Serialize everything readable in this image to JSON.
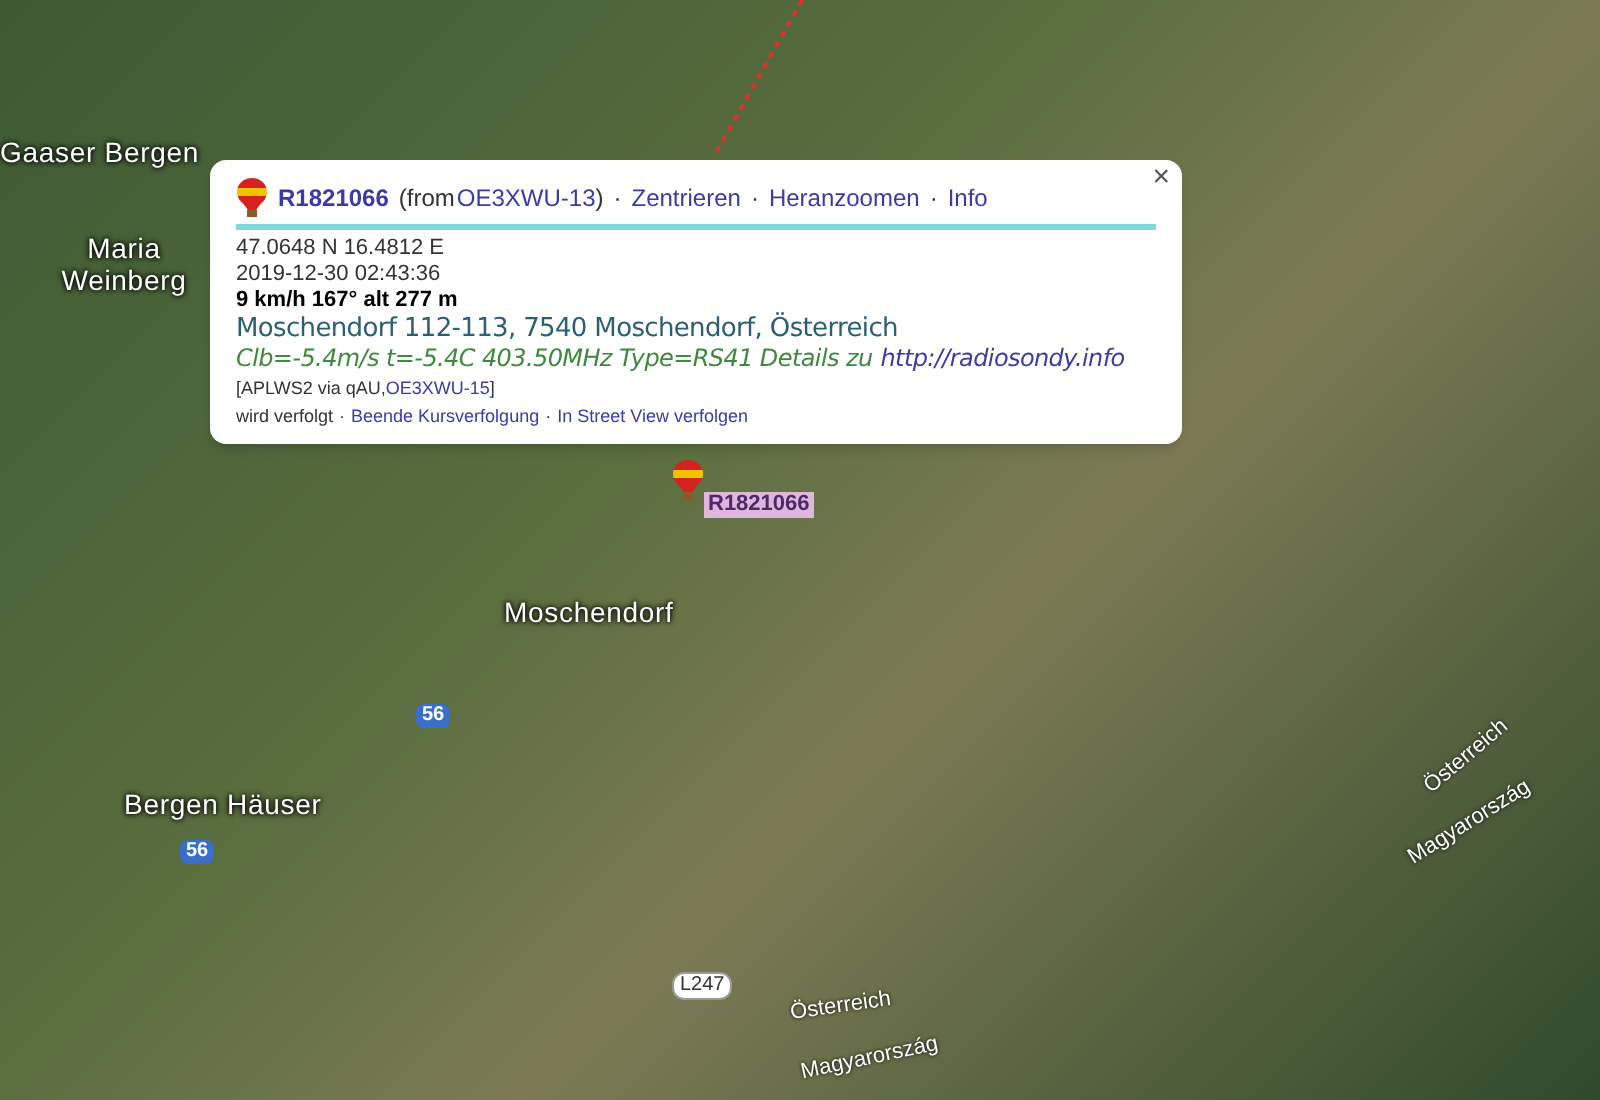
{
  "map": {
    "labels": [
      {
        "text": "Gaaser Bergen",
        "kind": "place"
      },
      {
        "text": "Maria Weinberg",
        "kind": "place"
      },
      {
        "text": "Moschendorf",
        "kind": "place"
      },
      {
        "text": "Bergen Häuser",
        "kind": "place"
      },
      {
        "text": "56",
        "kind": "shield"
      },
      {
        "text": "56",
        "kind": "shield"
      },
      {
        "text": "L247",
        "kind": "road"
      },
      {
        "text": "Österreich",
        "kind": "border"
      },
      {
        "text": "Magyarország",
        "kind": "border"
      },
      {
        "text": "Österreich",
        "kind": "border"
      },
      {
        "text": "Magyarország",
        "kind": "border"
      }
    ]
  },
  "popup": {
    "close": "×",
    "header": {
      "callsign": "R1821066",
      "source_prefix": "(from",
      "source": "OE3XWU-13",
      "source_suffix": ")",
      "separator": "·",
      "links": [
        "Zentrieren",
        "Heranzoomen",
        "Info"
      ]
    },
    "position": "47.0648 N 16.4812 E",
    "time": "2019-12-30 02:43:36",
    "motion": "9 km/h 167° alt 277 m",
    "address": "Moschendorf 112-113, 7540 Moschendorf, Österreich",
    "comment": "Clb=-5.4m/s t=-5.4C 403.50MHz Type=RS41 Details zu",
    "comment_link": "http://radiosondy.info",
    "path_prefix": "[APLWS2 via qAU,",
    "path_link": "OE3XWU-15",
    "path_suffix": "]",
    "tracking": "wird verfolgt",
    "tracking_links": [
      "Beende Kursverfolgung",
      "In Street View verfolgen"
    ]
  },
  "marker": {
    "label": "R1821066"
  }
}
